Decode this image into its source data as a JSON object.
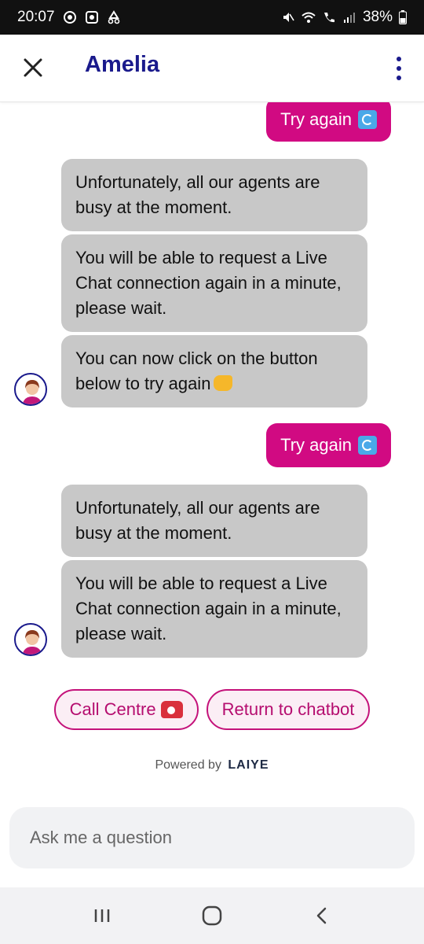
{
  "status_bar": {
    "time": "20:07",
    "battery": "38%"
  },
  "header": {
    "title": "Amelia"
  },
  "messages": {
    "user_try_again_1": "Try again",
    "bot_busy_1": "Unfortunately, all our agents are busy at the moment.",
    "bot_wait_1": "You will be able to request a Live Chat connection again in a minute, please wait.",
    "bot_click_below": "You can now click on the button below to try again",
    "user_try_again_2": "Try again",
    "bot_busy_2": "Unfortunately, all our agents are busy at the moment.",
    "bot_wait_2": "You will be able to request a Live Chat connection again in a minute, please wait."
  },
  "quick_replies": {
    "call_centre": "Call Centre",
    "return_to_chatbot": "Return to chatbot"
  },
  "footer": {
    "powered_by": "Powered by",
    "brand": "LAIYE"
  },
  "input": {
    "placeholder": "Ask me a question"
  },
  "colors": {
    "accent": "#d10a82",
    "title": "#1a1a8c",
    "bot_bubble": "#c8c8c8"
  },
  "icons": {
    "close": "close-icon",
    "menu": "more-vertical-icon",
    "refresh": "refresh-emoji-icon",
    "pointing": "point-down-emoji-icon",
    "phone": "telephone-emoji-icon"
  }
}
